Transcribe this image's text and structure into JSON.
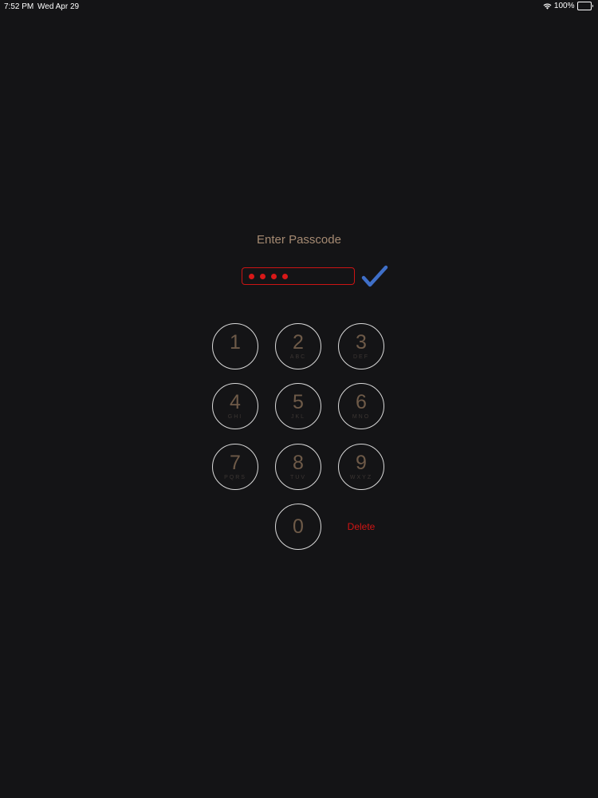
{
  "status_bar": {
    "time": "7:52 PM",
    "date": "Wed Apr 29",
    "battery": "100%",
    "wifi_icon": "wifi-icon",
    "battery_icon": "battery-icon"
  },
  "title": "Enter Passcode",
  "passcode": {
    "entered_digits": 4,
    "dot_color": "#d81818",
    "border_color": "#cc1414"
  },
  "confirm_icon": "checkmark-icon",
  "keys": [
    {
      "digit": "1",
      "letters": ""
    },
    {
      "digit": "2",
      "letters": "ABC"
    },
    {
      "digit": "3",
      "letters": "DEF"
    },
    {
      "digit": "4",
      "letters": "GHI"
    },
    {
      "digit": "5",
      "letters": "JKL"
    },
    {
      "digit": "6",
      "letters": "MNO"
    },
    {
      "digit": "7",
      "letters": "PQRS"
    },
    {
      "digit": "8",
      "letters": "TUV"
    },
    {
      "digit": "9",
      "letters": "WXYZ"
    },
    {
      "digit": "0",
      "letters": ""
    }
  ],
  "delete_label": "Delete",
  "colors": {
    "background": "#141416",
    "title": "#a58a72",
    "key_border": "#d9d9d9",
    "key_digit": "#6e5a48",
    "checkmark": "#3f6fc8",
    "delete": "#d11414"
  }
}
